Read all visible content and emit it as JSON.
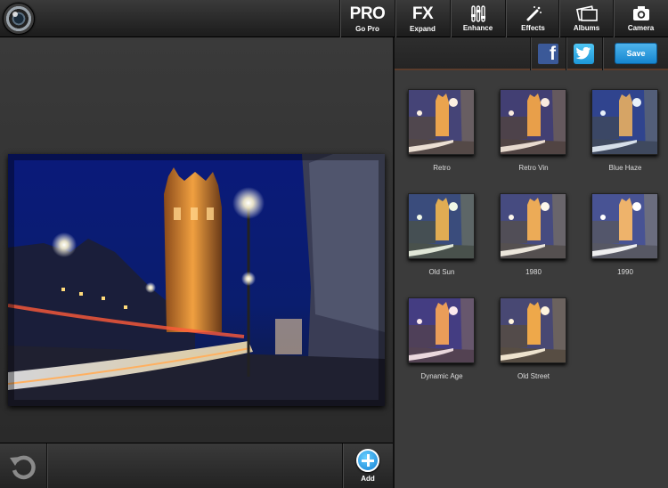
{
  "toolbar": {
    "buttons": [
      {
        "big": "PRO",
        "label": "Go Pro"
      },
      {
        "big": "FX",
        "label": "Expand"
      },
      {
        "label": "Enhance",
        "icon": "enhance-icon"
      },
      {
        "label": "Effects",
        "icon": "magic-wand-icon"
      },
      {
        "label": "Albums",
        "icon": "albums-icon"
      },
      {
        "label": "Camera",
        "icon": "camera-icon"
      }
    ]
  },
  "share": {
    "save_label": "Save",
    "facebook_glyph": "f"
  },
  "bottom": {
    "add_label": "Add"
  },
  "filters": [
    {
      "label": "Retro",
      "tint": "#f2c48a"
    },
    {
      "label": "Retro Vin",
      "tint": "#e7b07a"
    },
    {
      "label": "Blue Haze",
      "tint": "#9fc5e8"
    },
    {
      "label": "Old Sun",
      "tint": "#c9e3a0"
    },
    {
      "label": "1980",
      "tint": "#f6e1b0"
    },
    {
      "label": "1990",
      "tint": "#ffffff"
    },
    {
      "label": "Dynamic Age",
      "tint": "#f0a8b8"
    },
    {
      "label": "Old Street",
      "tint": "#ffd27a"
    }
  ],
  "colors": {
    "accent": "#1686cf",
    "facebook": "#3b5998",
    "twitter": "#1d97d8"
  }
}
